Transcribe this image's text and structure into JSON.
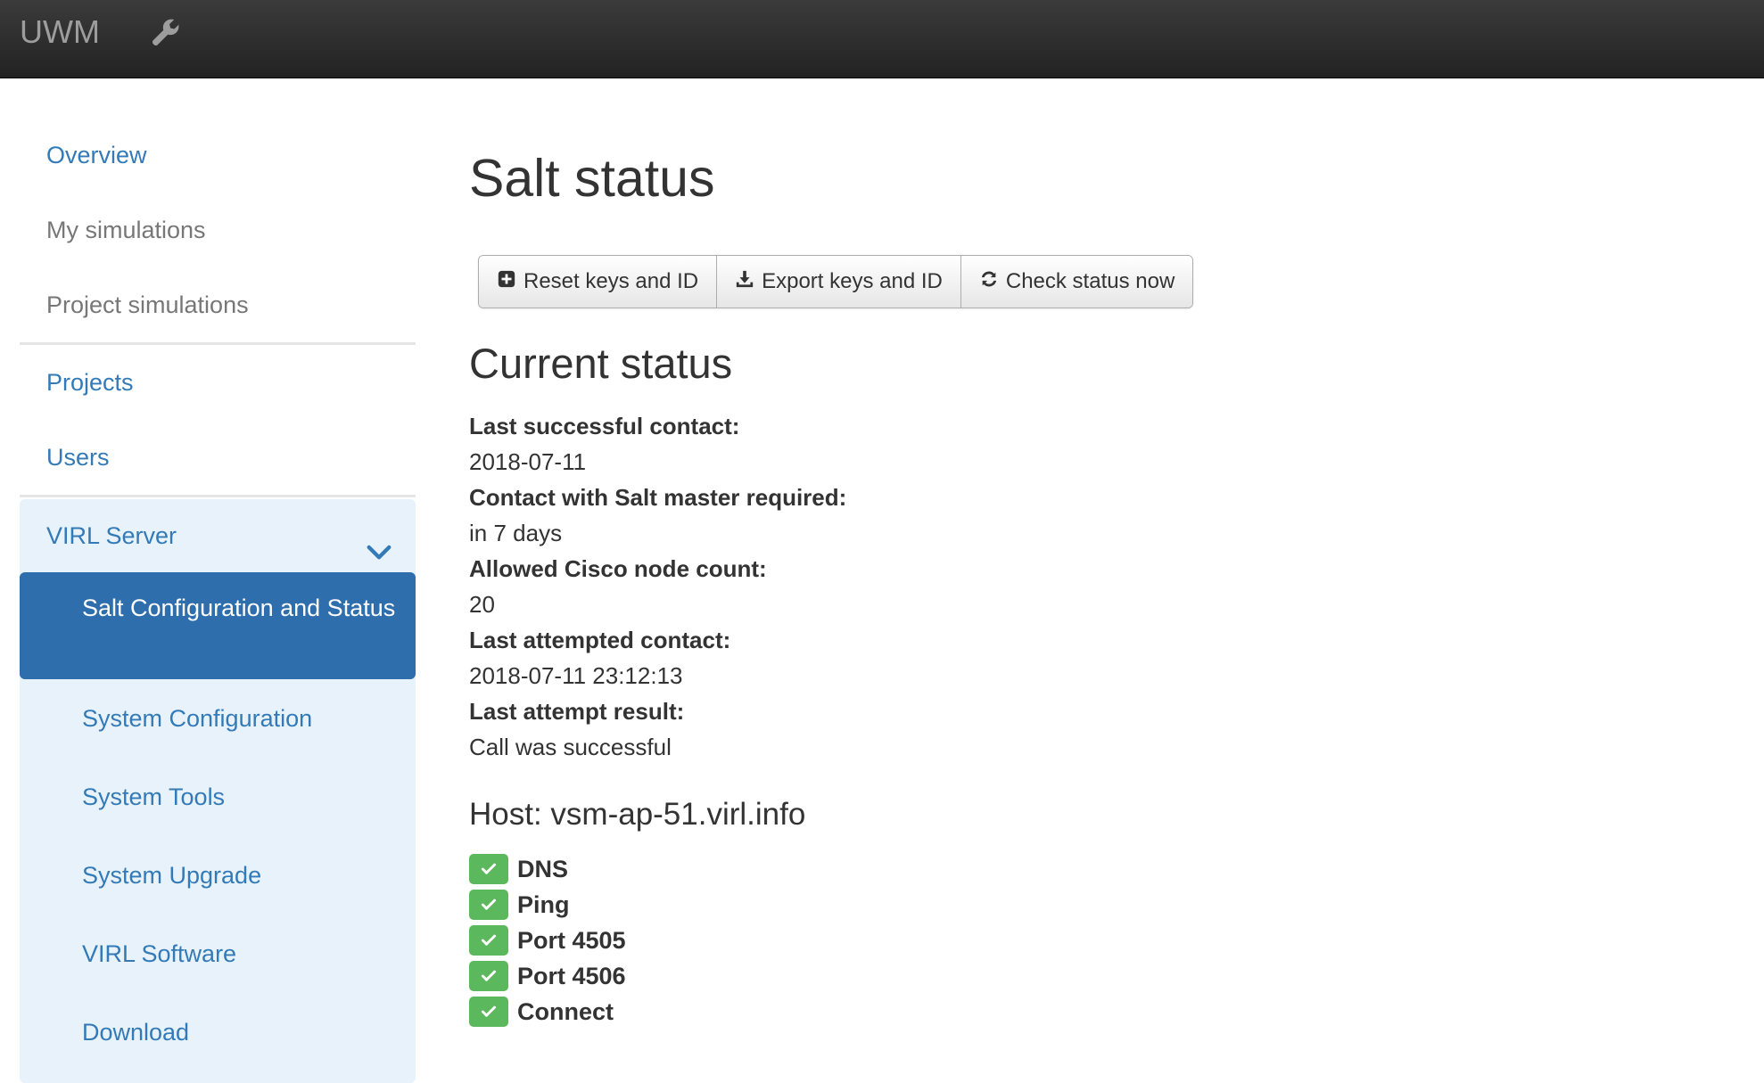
{
  "navbar": {
    "brand": "UWM"
  },
  "sidebar": {
    "items": [
      {
        "label": "Overview"
      },
      {
        "label": "My simulations"
      },
      {
        "label": "Project simulations"
      },
      {
        "label": "Projects"
      },
      {
        "label": "Users"
      }
    ],
    "group": {
      "label": "VIRL Server",
      "items": [
        {
          "label": "Salt Configuration and Status",
          "active": true
        },
        {
          "label": "System Configuration"
        },
        {
          "label": "System Tools"
        },
        {
          "label": "System Upgrade"
        },
        {
          "label": "VIRL Software"
        },
        {
          "label": "Download"
        }
      ]
    }
  },
  "main": {
    "title": "Salt status",
    "buttons": {
      "reset": "Reset keys and ID",
      "export": "Export keys and ID",
      "check": "Check status now"
    },
    "current_status": {
      "heading": "Current status",
      "fields": [
        {
          "label": "Last successful contact:",
          "value": "2018-07-11"
        },
        {
          "label": "Contact with Salt master required:",
          "value": "in 7 days"
        },
        {
          "label": "Allowed Cisco node count:",
          "value": "20"
        },
        {
          "label": "Last attempted contact:",
          "value": "2018-07-11 23:12:13"
        },
        {
          "label": "Last attempt result:",
          "value": "Call was successful"
        }
      ]
    },
    "host": {
      "title": "Host: vsm-ap-51.virl.info",
      "checks": [
        {
          "label": "DNS",
          "status": "ok"
        },
        {
          "label": "Ping",
          "status": "ok"
        },
        {
          "label": "Port 4505",
          "status": "ok"
        },
        {
          "label": "Port 4506",
          "status": "ok"
        },
        {
          "label": "Connect",
          "status": "ok"
        }
      ]
    }
  },
  "icons": {
    "navbar_tool": "wrench-icon",
    "group_toggle": "chevron-down-icon",
    "reset": "plus-square-icon",
    "export": "download-icon",
    "check": "refresh-icon",
    "status_ok": "check-icon"
  },
  "colors": {
    "navbar": "#222222",
    "link": "#337ab7",
    "active_bg": "#2f6eac",
    "group_bg": "#e8f2fb",
    "success": "#5cb85c"
  }
}
